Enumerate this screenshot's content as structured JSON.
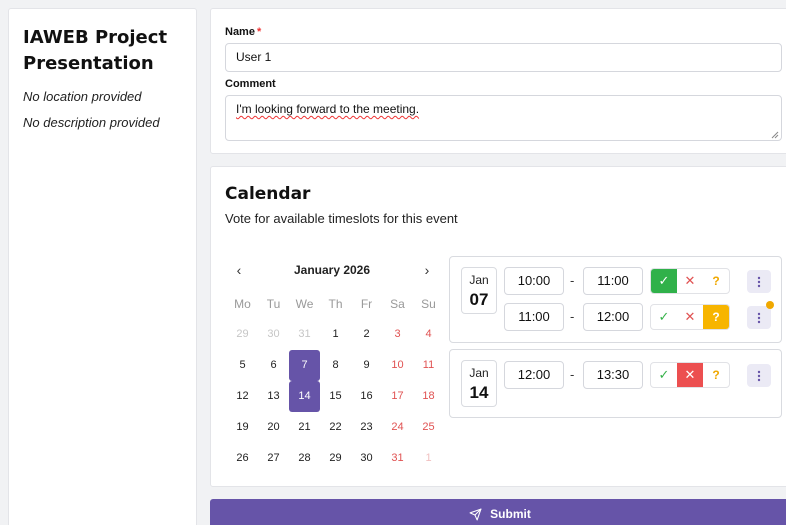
{
  "event": {
    "title": "IAWEB Project Presentation",
    "location": "No location provided",
    "description": "No description provided"
  },
  "form": {
    "name_label": "Name",
    "required_mark": "*",
    "name_value": "User 1",
    "comment_label": "Comment",
    "comment_value": "I'm looking forward to the meeting."
  },
  "calendar": {
    "title": "Calendar",
    "subtitle": "Vote for available timeslots for this event",
    "month": "January 2026",
    "prev_icon": "‹",
    "next_icon": "›",
    "weekdays": [
      "Mo",
      "Tu",
      "We",
      "Th",
      "Fr",
      "Sa",
      "Su"
    ],
    "days": [
      {
        "label": "29",
        "muted": true,
        "weekend": false,
        "selected": false
      },
      {
        "label": "30",
        "muted": true,
        "weekend": false,
        "selected": false
      },
      {
        "label": "31",
        "muted": true,
        "weekend": false,
        "selected": false
      },
      {
        "label": "1",
        "muted": false,
        "weekend": false,
        "selected": false
      },
      {
        "label": "2",
        "muted": false,
        "weekend": false,
        "selected": false
      },
      {
        "label": "3",
        "muted": false,
        "weekend": true,
        "selected": false
      },
      {
        "label": "4",
        "muted": false,
        "weekend": true,
        "selected": false
      },
      {
        "label": "5",
        "muted": false,
        "weekend": false,
        "selected": false
      },
      {
        "label": "6",
        "muted": false,
        "weekend": false,
        "selected": false
      },
      {
        "label": "7",
        "muted": false,
        "weekend": false,
        "selected": true
      },
      {
        "label": "8",
        "muted": false,
        "weekend": false,
        "selected": false
      },
      {
        "label": "9",
        "muted": false,
        "weekend": false,
        "selected": false
      },
      {
        "label": "10",
        "muted": false,
        "weekend": true,
        "selected": false
      },
      {
        "label": "11",
        "muted": false,
        "weekend": true,
        "selected": false
      },
      {
        "label": "12",
        "muted": false,
        "weekend": false,
        "selected": false
      },
      {
        "label": "13",
        "muted": false,
        "weekend": false,
        "selected": false
      },
      {
        "label": "14",
        "muted": false,
        "weekend": false,
        "selected": true
      },
      {
        "label": "15",
        "muted": false,
        "weekend": false,
        "selected": false
      },
      {
        "label": "16",
        "muted": false,
        "weekend": false,
        "selected": false
      },
      {
        "label": "17",
        "muted": false,
        "weekend": true,
        "selected": false
      },
      {
        "label": "18",
        "muted": false,
        "weekend": true,
        "selected": false
      },
      {
        "label": "19",
        "muted": false,
        "weekend": false,
        "selected": false
      },
      {
        "label": "20",
        "muted": false,
        "weekend": false,
        "selected": false
      },
      {
        "label": "21",
        "muted": false,
        "weekend": false,
        "selected": false
      },
      {
        "label": "22",
        "muted": false,
        "weekend": false,
        "selected": false
      },
      {
        "label": "23",
        "muted": false,
        "weekend": false,
        "selected": false
      },
      {
        "label": "24",
        "muted": false,
        "weekend": true,
        "selected": false
      },
      {
        "label": "25",
        "muted": false,
        "weekend": true,
        "selected": false
      },
      {
        "label": "26",
        "muted": false,
        "weekend": false,
        "selected": false
      },
      {
        "label": "27",
        "muted": false,
        "weekend": false,
        "selected": false
      },
      {
        "label": "28",
        "muted": false,
        "weekend": false,
        "selected": false
      },
      {
        "label": "29",
        "muted": false,
        "weekend": false,
        "selected": false
      },
      {
        "label": "30",
        "muted": false,
        "weekend": false,
        "selected": false
      },
      {
        "label": "31",
        "muted": false,
        "weekend": true,
        "selected": false
      },
      {
        "label": "1",
        "muted": true,
        "weekend": true,
        "selected": false
      }
    ]
  },
  "timeslots": {
    "group1": {
      "month": "Jan",
      "day": "07",
      "slot1": {
        "start": "10:00",
        "end": "11:00",
        "vote": "yes"
      },
      "slot2": {
        "start": "11:00",
        "end": "12:00",
        "vote": "maybe"
      }
    },
    "group2": {
      "month": "Jan",
      "day": "14",
      "slot1": {
        "start": "12:00",
        "end": "13:30",
        "vote": "no"
      }
    },
    "separator": "-",
    "vote_icons": {
      "yes": "✓",
      "no": "✕",
      "maybe": "?"
    }
  },
  "colors": {
    "accent": "#6654a8",
    "yes": "#30b14a",
    "no": "#ec4f50",
    "maybe": "#f7b500"
  },
  "submit": {
    "label": "Submit",
    "icon": "send-icon"
  }
}
